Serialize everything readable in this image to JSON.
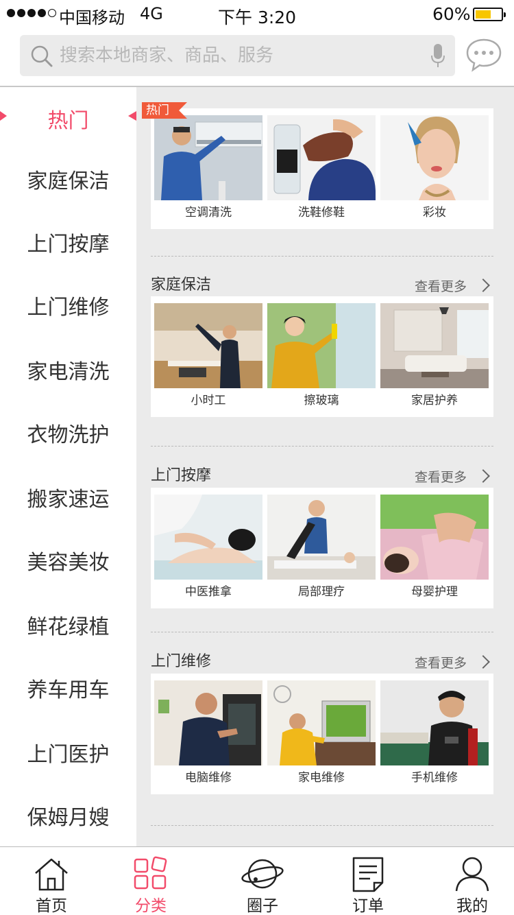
{
  "status_bar": {
    "carrier": "中国移动",
    "network": "4G",
    "time": "下午 3:20",
    "battery": "60%",
    "battery_level": 0.6
  },
  "search": {
    "placeholder": "搜索本地商家、商品、服务"
  },
  "sidebar": {
    "items": [
      {
        "label": "热门",
        "active": true
      },
      {
        "label": "家庭保洁"
      },
      {
        "label": "上门按摩"
      },
      {
        "label": "上门维修"
      },
      {
        "label": "家电清洗"
      },
      {
        "label": "衣物洗护"
      },
      {
        "label": "搬家速运"
      },
      {
        "label": "美容美妆"
      },
      {
        "label": "鲜花绿植"
      },
      {
        "label": "养车用车"
      },
      {
        "label": "上门医护"
      },
      {
        "label": "保姆月嫂"
      }
    ]
  },
  "sections": {
    "hot": {
      "badge": "热门",
      "items": [
        "空调清洗",
        "洗鞋修鞋",
        "彩妆"
      ]
    },
    "cleaning": {
      "title": "家庭保洁",
      "more": "查看更多",
      "items": [
        "小时工",
        "擦玻璃",
        "家居护养"
      ]
    },
    "massage": {
      "title": "上门按摩",
      "more": "查看更多",
      "items": [
        "中医推拿",
        "局部理疗",
        "母婴护理"
      ]
    },
    "repair": {
      "title": "上门维修",
      "more": "查看更多",
      "items": [
        "电脑维修",
        "家电维修",
        "手机维修"
      ]
    }
  },
  "tab_bar": {
    "tabs": [
      {
        "label": "首页",
        "icon": "home-icon"
      },
      {
        "label": "分类",
        "icon": "category-icon",
        "active": true
      },
      {
        "label": "圈子",
        "icon": "planet-icon"
      },
      {
        "label": "订单",
        "icon": "order-icon"
      },
      {
        "label": "我的",
        "icon": "user-icon"
      }
    ]
  },
  "colors": {
    "accent": "#f24b6a",
    "badge": "#f05a3a",
    "battery": "#f7c600",
    "content_bg": "#ebebeb"
  }
}
